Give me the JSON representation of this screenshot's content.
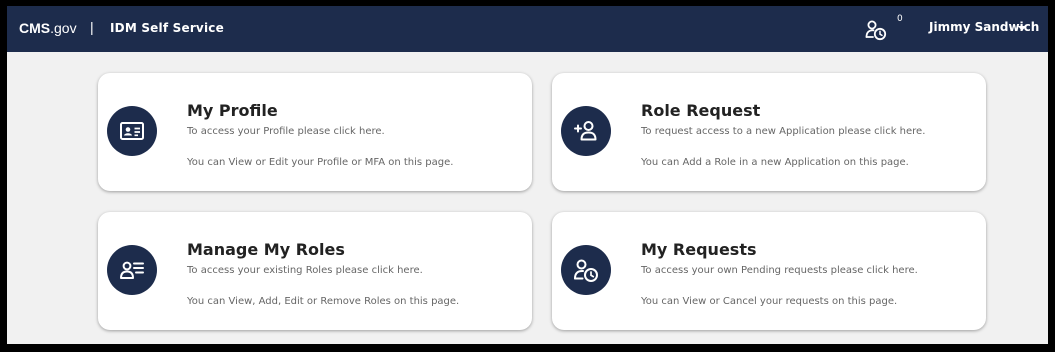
{
  "header": {
    "brand_bold": "CMS",
    "brand_rest": ".gov",
    "separator": "|",
    "app_title": "IDM Self Service",
    "requests_count": "0",
    "requests_icon": "user-clock-icon",
    "user_name": "Jimmy Sandwich",
    "menu_icon": "caret-down-icon"
  },
  "cards": [
    {
      "title": "My Profile",
      "line1": "To access your Profile please click here.",
      "line2": "You can View or Edit your Profile or MFA on this page.",
      "icon": "id-card-icon"
    },
    {
      "title": "Role Request",
      "line1": "To request access to a new Application please click here.",
      "line2": "You can Add a Role in a new Application on this page.",
      "icon": "user-plus-icon"
    },
    {
      "title": "Manage My Roles",
      "line1": "To access your existing Roles please click here.",
      "line2": "You can View, Add, Edit or Remove Roles on this page.",
      "icon": "user-list-icon"
    },
    {
      "title": "My Requests",
      "line1": "To access your own Pending requests please click here.",
      "line2": "You can View or Cancel your requests on this page.",
      "icon": "user-clock-icon"
    }
  ],
  "colors": {
    "navy": "#1d2c4c",
    "background": "#f1f1f1",
    "card": "#ffffff"
  }
}
